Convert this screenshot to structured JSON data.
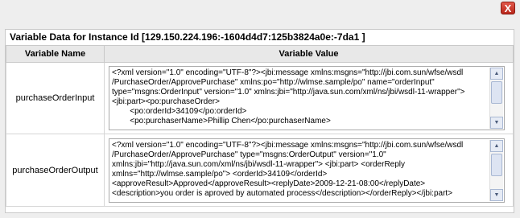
{
  "dialog": {
    "close_label": "X",
    "title": "Variable Data for Instance Id [129.150.224.196:-1604d4d7:125b3824a0e:-7da1 ]"
  },
  "table": {
    "headers": [
      "Variable Name",
      "Variable Value"
    ],
    "rows": [
      {
        "name": "purchaseOrderInput",
        "value": "<?xml version=\"1.0\" encoding=\"UTF-8\"?><jbi:message xmlns:msgns=\"http://jbi.com.sun/wfse/wsdl\n/PurchaseOrder/ApprovePurchase\" xmlns:po=\"http://wlmse.sample/po\" name=\"orderInput\"\ntype=\"msgns:OrderInput\" version=\"1.0\" xmlns:jbi=\"http://java.sun.com/xml/ns/jbi/wsdl-11-wrapper\">\n<jbi:part><po:purchaseOrder>\n        <po:orderId>34109</po:orderId>\n        <po:purchaserName>Phillip Chen</po:purchaserName>"
      },
      {
        "name": "purchaseOrderOutput",
        "value": "<?xml version=\"1.0\" encoding=\"UTF-8\"?><jbi:message xmlns:msgns=\"http://jbi.com.sun/wfse/wsdl\n/PurchaseOrder/ApprovePurchase\" type=\"msgns:OrderOutput\" version=\"1.0\"\nxmlns:jbi=\"http://java.sun.com/xml/ns/jbi/wsdl-11-wrapper\"> <jbi:part> <orderReply\nxmlns=\"http://wlmse.sample/po\"> <orderId>34109</orderId>\n<approveResult>Approved</approveResult><replyDate>2009-12-21-08:00</replyDate>\n<description>you order is aproved by automated process</description></orderReply></jbi:part>"
      }
    ]
  },
  "icons": {
    "close": "close-icon",
    "scroll_up": "arrow-up-icon",
    "scroll_down": "arrow-down-icon"
  }
}
